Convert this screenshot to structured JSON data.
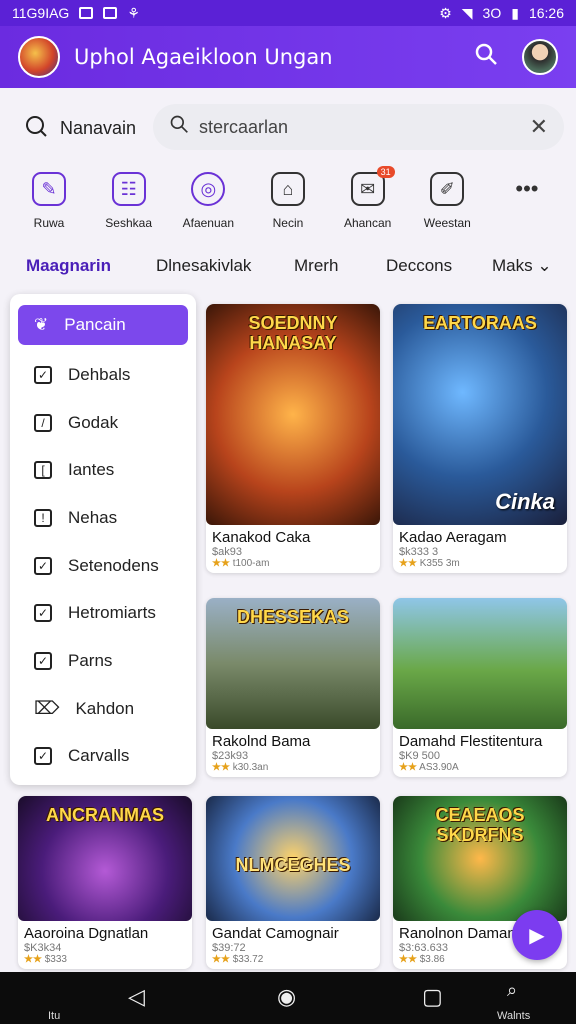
{
  "status_bar": {
    "left_text": "11G9IAG",
    "right_text": "3O",
    "time": "16:26"
  },
  "app_bar": {
    "title": "Uphol Agaeikloon Ungan",
    "search_icon": "search-icon",
    "avatar": "avatar"
  },
  "search": {
    "label": "Nanavain",
    "query": "stercaarlan",
    "icons": {
      "left": "search-icon",
      "clear": "close-icon"
    }
  },
  "quick_actions": [
    {
      "label": "Ruwa",
      "icon": "gamepad-icon"
    },
    {
      "label": "Seshkaa",
      "icon": "chat-icon"
    },
    {
      "label": "Afaenuan",
      "icon": "target-icon"
    },
    {
      "label": "Necin",
      "icon": "house-icon"
    },
    {
      "label": "Ahancan",
      "icon": "message-icon",
      "badge": "31"
    },
    {
      "label": "Weestan",
      "icon": "pencil-icon"
    },
    {
      "label": "...",
      "icon": "more-icon"
    }
  ],
  "tabs": [
    "Maagnarin",
    "Dlnesakivlak",
    "Mrerh",
    "Deccons",
    "Maks"
  ],
  "dropdown": {
    "selected": "Pancain",
    "items": [
      "Dehbals",
      "Godak",
      "Iantes",
      "Nehas",
      "Setenodens",
      "Hetromiarts",
      "Parns",
      "Kahdon",
      "Carvalls"
    ]
  },
  "cards": [
    {
      "name": "Kanakod Caka",
      "price": "$ak93",
      "rating": "★★",
      "rating_text": "t100-am",
      "banner": "SOEDNNY HANASAY",
      "art": ""
    },
    {
      "name": "Kadao Aeragam",
      "price": "$k333 3",
      "rating": "★★",
      "rating_text": "K355 3m",
      "banner": "EARTORAAS",
      "art": "Cinka"
    },
    {
      "name": "Rakolnd Bama",
      "price": "$23k93",
      "rating": "★★",
      "rating_text": "k30.3an",
      "banner": "DHESSEKAS",
      "art": ""
    },
    {
      "name": "Damahd Flestitentura",
      "price": "$K9 500",
      "rating": "★★",
      "rating_text": "AS3.90A",
      "banner": "",
      "art": ""
    },
    {
      "name": "Aaoroina Dgnatlan",
      "price": "$K3k34",
      "rating": "★★",
      "rating_text": "$333",
      "banner": "ANCRANMAS",
      "art": ""
    },
    {
      "name": "Gandat Camognair",
      "price": "$39:72",
      "rating": "★★",
      "rating_text": "$33.72",
      "banner": "NLMCEGHES",
      "art": ""
    },
    {
      "name": "Ranolnon Daman",
      "price": "$3:63.633",
      "rating": "★★",
      "rating_text": "$3.86",
      "banner": "CEAEAOS SKDRFNS",
      "art": ""
    }
  ],
  "nav_bar": {
    "left_caption": "Itu",
    "right_caption": "Walnts"
  }
}
